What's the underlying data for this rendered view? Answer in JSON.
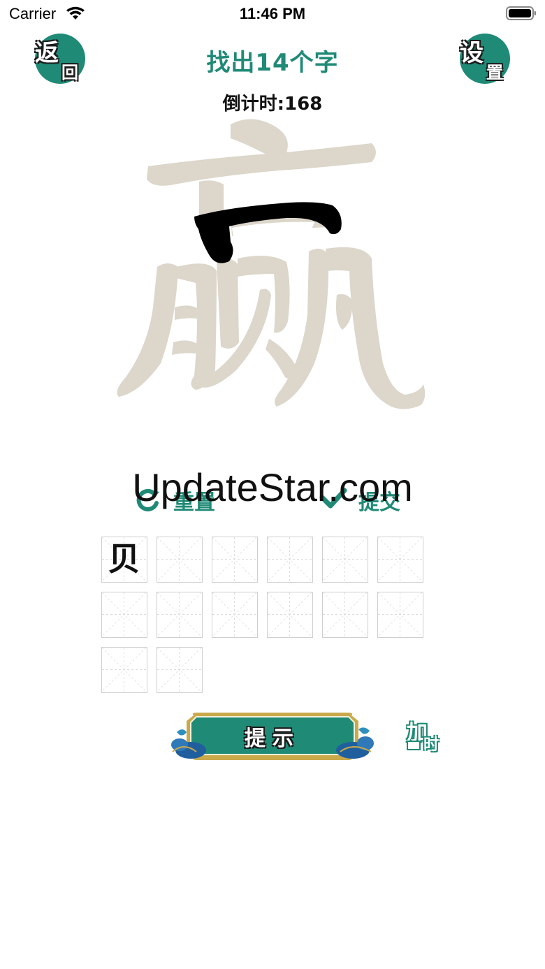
{
  "status_bar": {
    "carrier": "Carrier",
    "time": "11:46 PM",
    "icons": [
      "wifi-icon",
      "battery-icon"
    ]
  },
  "header": {
    "back_label_top": "返",
    "back_label_bottom": "回",
    "settings_label_top": "设",
    "settings_label_bottom": "置",
    "title": "找出14个字",
    "countdown": "倒计时:168"
  },
  "puzzle": {
    "character": "赢",
    "highlighted_stroke": "口",
    "colors": {
      "base": "#dcd6cb",
      "highlight": "#000000"
    }
  },
  "watermark": "UpdateStar.com",
  "actions": {
    "reset_label": "重置",
    "submit_label": "提交"
  },
  "answers": {
    "total_slots": 14,
    "slots": [
      "贝",
      "",
      "",
      "",
      "",
      "",
      "",
      "",
      "",
      "",
      "",
      "",
      "",
      ""
    ]
  },
  "bottom": {
    "hint_label": "提示",
    "addtime_top": "加",
    "addtime_bottom": "时"
  },
  "colors": {
    "accent": "#1f8a76",
    "cloud_blue": "#1f5f9e",
    "gold": "#c9a94a"
  }
}
